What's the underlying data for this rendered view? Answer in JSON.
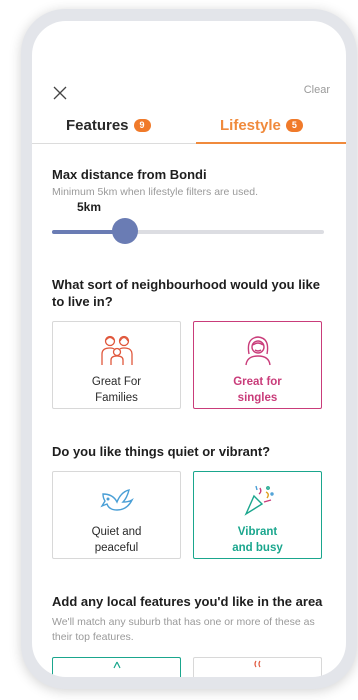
{
  "header": {
    "close_icon": "close-icon",
    "clear_label": "Clear"
  },
  "tabs": [
    {
      "label": "Features",
      "badge": "9",
      "active": false
    },
    {
      "label": "Lifestyle",
      "badge": "5",
      "active": true
    }
  ],
  "distance": {
    "title": "Max distance from Bondi",
    "subtitle": "Minimum 5km when lifestyle filters are used.",
    "value_label": "5km",
    "slider_fraction": 0.27
  },
  "neighbourhood": {
    "title": "What sort of neighbourhood would you like to live in?",
    "options": [
      {
        "label_line1": "Great For",
        "label_line2": "Families",
        "icon": "family-icon",
        "selected": false
      },
      {
        "label_line1": "Great for",
        "label_line2": "singles",
        "icon": "single-person-icon",
        "selected": true
      }
    ]
  },
  "vibe": {
    "title": "Do you like things quiet or vibrant?",
    "options": [
      {
        "label_line1": "Quiet and",
        "label_line2": "peaceful",
        "icon": "dove-icon",
        "selected": false
      },
      {
        "label_line1": "Vibrant",
        "label_line2": "and busy",
        "icon": "party-popper-icon",
        "selected": true
      }
    ]
  },
  "local_features": {
    "title": "Add any local features you'd like in the area",
    "subtitle": "We'll match any suburb that has one or more of these as their top features."
  },
  "colors": {
    "accent_orange": "#f08a3c",
    "slider_blue": "#6a7cb4",
    "selected_pink": "#c93c7a",
    "selected_teal": "#1aa68d"
  }
}
